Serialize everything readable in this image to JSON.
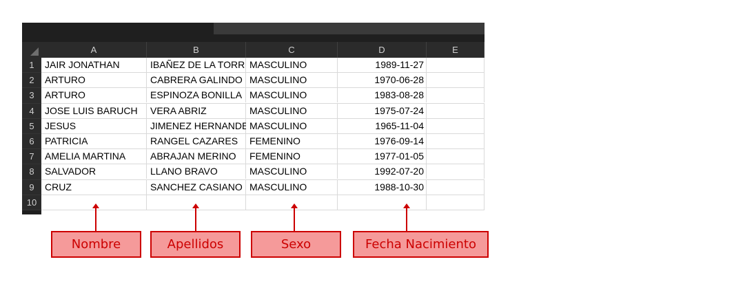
{
  "columns": [
    "A",
    "B",
    "C",
    "D",
    "E"
  ],
  "row_numbers": [
    "1",
    "2",
    "3",
    "4",
    "5",
    "6",
    "7",
    "8",
    "9",
    "10"
  ],
  "rows": [
    {
      "a": "JAIR JONATHAN",
      "b": "IBAÑEZ DE LA TORRE",
      "c": "MASCULINO",
      "d": "1989-11-27"
    },
    {
      "a": "ARTURO",
      "b": "CABRERA GALINDO",
      "c": "MASCULINO",
      "d": "1970-06-28"
    },
    {
      "a": "ARTURO",
      "b": "ESPINOZA BONILLA",
      "c": "MASCULINO",
      "d": "1983-08-28"
    },
    {
      "a": "JOSE LUIS BARUCH",
      "b": "VERA ABRIZ",
      "c": "MASCULINO",
      "d": "1975-07-24"
    },
    {
      "a": "JESUS",
      "b": "JIMENEZ HERNANDEZ",
      "c": "MASCULINO",
      "d": "1965-11-04"
    },
    {
      "a": "PATRICIA",
      "b": "RANGEL CAZARES",
      "c": "FEMENINO",
      "d": "1976-09-14"
    },
    {
      "a": "AMELIA MARTINA",
      "b": "ABRAJAN MERINO",
      "c": "FEMENINO",
      "d": "1977-01-05"
    },
    {
      "a": "SALVADOR",
      "b": "LLANO BRAVO",
      "c": "MASCULINO",
      "d": "1992-07-20"
    },
    {
      "a": "CRUZ",
      "b": "SANCHEZ CASIANO",
      "c": "MASCULINO",
      "d": "1988-10-30"
    }
  ],
  "labels": {
    "nombre": "Nombre",
    "apellidos": "Apellidos",
    "sexo": "Sexo",
    "fecha": "Fecha Nacimiento"
  },
  "colors": {
    "label_fill": "#f59a9a",
    "label_border": "#cc0000",
    "sheet_dark": "#1f1f1f"
  }
}
